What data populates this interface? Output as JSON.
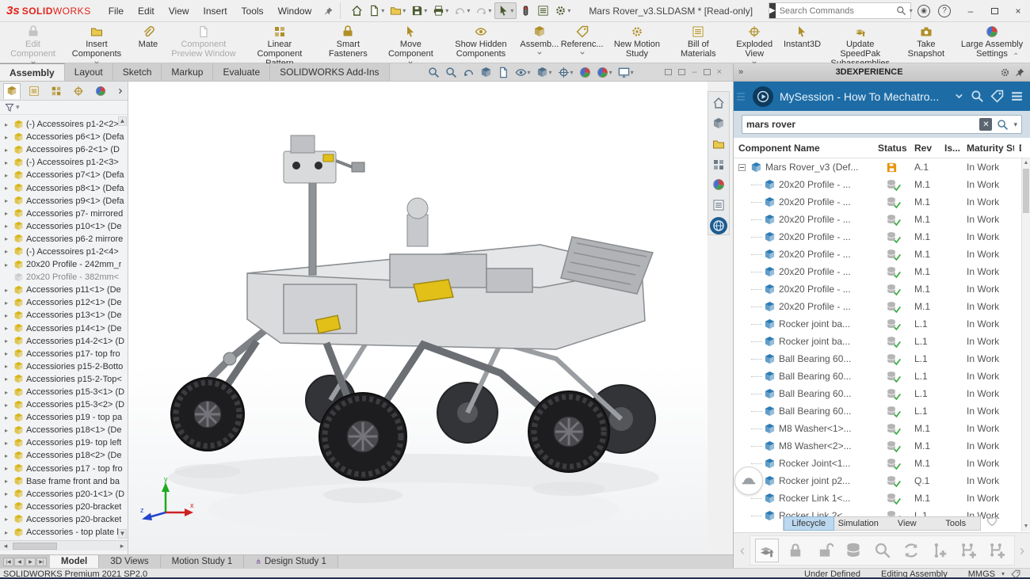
{
  "brand": {
    "mark": "3s",
    "name_bold": "SOLID",
    "name_light": "WORKS"
  },
  "titlebar": {
    "menus": [
      {
        "label": "File"
      },
      {
        "label": "Edit"
      },
      {
        "label": "View"
      },
      {
        "label": "Insert"
      },
      {
        "label": "Tools"
      },
      {
        "label": "Window"
      }
    ],
    "quick_access": [
      {
        "name": "home",
        "sym": "home"
      },
      {
        "name": "new-document",
        "sym": "doc",
        "dd": true
      },
      {
        "name": "open",
        "sym": "folder",
        "dd": true
      },
      {
        "name": "save",
        "sym": "floppy",
        "dd": true
      },
      {
        "name": "print",
        "sym": "printer",
        "dd": true
      },
      {
        "name": "undo",
        "sym": "undo",
        "dd": true,
        "dis": true
      },
      {
        "name": "redo",
        "sym": "redo",
        "dd": true,
        "dis": true
      },
      {
        "name": "select",
        "sym": "cursor",
        "dd": true,
        "sel": true
      },
      {
        "name": "connection-status",
        "sym": "traffic"
      },
      {
        "name": "task-pane-toggle",
        "sym": "list"
      },
      {
        "name": "options",
        "sym": "gear",
        "dd": true
      }
    ],
    "title": "Mars Rover_v3.SLDASM * [Read-only]",
    "search_placeholder": "Search Commands",
    "help_glyph": "?"
  },
  "ribbon": {
    "buttons": [
      {
        "name": "edit-component",
        "sym": "tool",
        "label": "Edit Component",
        "dd": true,
        "dis": true
      },
      {
        "name": "insert-components",
        "sym": "folder",
        "label": "Insert Components",
        "dd": true
      },
      {
        "name": "mate",
        "sym": "clip",
        "label": "Mate"
      },
      {
        "name": "component-preview-window",
        "sym": "doc",
        "label": "Component Preview Window",
        "dis": true
      },
      {
        "name": "linear-component-pattern",
        "sym": "grid",
        "label": "Linear Component Pattern",
        "dd": true
      },
      {
        "name": "smart-fasteners",
        "sym": "tool",
        "label": "Smart Fasteners"
      },
      {
        "name": "move-component",
        "sym": "cursor",
        "label": "Move Component",
        "dd": true
      },
      {
        "name": "show-hidden-components",
        "sym": "eye",
        "label": "Show Hidden Components"
      },
      {
        "name": "assembly-features",
        "sym": "cube",
        "label": "Assemb...",
        "dd": true
      },
      {
        "name": "reference-geometry",
        "sym": "tag",
        "label": "Referenc...",
        "dd": true
      },
      {
        "name": "new-motion-study",
        "sym": "gear",
        "label": "New Motion Study"
      },
      {
        "name": "bill-of-materials",
        "sym": "list",
        "label": "Bill of Materials"
      },
      {
        "name": "exploded-view",
        "sym": "target",
        "label": "Exploded View",
        "dd": true
      },
      {
        "name": "instant3d",
        "sym": "cursor",
        "label": "Instant3D"
      },
      {
        "name": "update-speedpak",
        "sym": "stackup",
        "label": "Update SpeedPak Subassemblies"
      },
      {
        "name": "take-snapshot",
        "sym": "camera",
        "label": "Take Snapshot"
      },
      {
        "name": "large-assembly-settings",
        "sym": "ball",
        "label": "Large Assembly Settings"
      }
    ]
  },
  "command_tabs": [
    {
      "label": "Assembly",
      "active": true
    },
    {
      "label": "Layout"
    },
    {
      "label": "Sketch"
    },
    {
      "label": "Markup"
    },
    {
      "label": "Evaluate"
    },
    {
      "label": "SOLIDWORKS Add-Ins"
    }
  ],
  "headsup": [
    {
      "name": "zoom-to-fit",
      "sym": "mag"
    },
    {
      "name": "zoom-to-area",
      "sym": "mag"
    },
    {
      "name": "previous-view",
      "sym": "undo"
    },
    {
      "name": "section-view",
      "sym": "cube"
    },
    {
      "name": "dynamic-annotation-views",
      "sym": "doc"
    },
    {
      "name": "hide-show-items",
      "sym": "eye",
      "dd": true
    },
    {
      "name": "display-style",
      "sym": "cube",
      "dd": true
    },
    {
      "name": "view-orientation",
      "sym": "target",
      "dd": true
    },
    {
      "name": "edit-appearance",
      "sym": "ball"
    },
    {
      "name": "apply-scene",
      "sym": "ball",
      "dd": true
    },
    {
      "name": "view-settings",
      "sym": "monitor",
      "dd": true
    }
  ],
  "tree": {
    "tabs": [
      {
        "name": "featuremanager",
        "sym": "cube",
        "active": true
      },
      {
        "name": "propertymanager",
        "sym": "list"
      },
      {
        "name": "configurationmanager",
        "sym": "grid"
      },
      {
        "name": "dimxpertmanager",
        "sym": "target"
      },
      {
        "name": "displaymanager",
        "sym": "ball"
      }
    ],
    "items": [
      {
        "label": "(-) Accessoires p1-2<2>"
      },
      {
        "label": "Accessories p6<1> (Defa"
      },
      {
        "label": "Accessoires p6-2<1> (D"
      },
      {
        "label": "(-) Accessoires p1-2<3>"
      },
      {
        "label": "Accessories p7<1> (Defa"
      },
      {
        "label": "Accessories p8<1> (Defa"
      },
      {
        "label": "Accessories p9<1> (Defa"
      },
      {
        "label": "Accessories p7- mirrored"
      },
      {
        "label": "Accessories p10<1> (De"
      },
      {
        "label": "Accessories p6-2 mirrore"
      },
      {
        "label": "(-) Accessoires p1-2<4>"
      },
      {
        "label": "20x20 Profile - 242mm_r"
      },
      {
        "label": "20x20 Profile - 382mm<",
        "ghost": true
      },
      {
        "label": "Accessories p11<1> (De"
      },
      {
        "label": "Accessories p12<1> (De"
      },
      {
        "label": "Accessories p13<1> (De"
      },
      {
        "label": "Accessories p14<1> (De"
      },
      {
        "label": "Accessories p14-2<1> (D"
      },
      {
        "label": "Accessories p17- top fro"
      },
      {
        "label": "Accessiories p15-2-Botto"
      },
      {
        "label": "Accessiories p15-2-Top<"
      },
      {
        "label": "Accessories p15-3<1> (D"
      },
      {
        "label": "Accessories p15-3<2> (D"
      },
      {
        "label": "Accessories p19 - top pa"
      },
      {
        "label": "Accessories p18<1> (De"
      },
      {
        "label": "Accessories p19- top left"
      },
      {
        "label": "Accessories p18<2> (De"
      },
      {
        "label": "Accessories p17 - top fro"
      },
      {
        "label": "Base frame front and ba"
      },
      {
        "label": "Accessories p20-1<1> (D"
      },
      {
        "label": "Accessories p20-bracket"
      },
      {
        "label": "Accessories p20-bracket"
      },
      {
        "label": "Accessories - top plate b"
      }
    ]
  },
  "taskstrip": [
    {
      "name": "home",
      "sym": "home"
    },
    {
      "name": "3dexperience-marketplace",
      "sym": "cube"
    },
    {
      "name": "design-library",
      "sym": "folder"
    },
    {
      "name": "appearances-scenes",
      "sym": "grid"
    },
    {
      "name": "custom-properties",
      "sym": "ball"
    },
    {
      "name": "file-explorer",
      "sym": "list"
    },
    {
      "name": "3dexperience",
      "sym": "globe",
      "active": true
    }
  ],
  "right_panel": {
    "header": "3DEXPERIENCE",
    "session": "MySession - How To Mechatro...",
    "search_value": "mars rover",
    "columns": [
      "Component Name",
      "Status",
      "Rev",
      "Is...",
      "Maturity State",
      "D"
    ],
    "rows": [
      {
        "name": "Mars Rover_v3 (Def...",
        "rev": "A.1",
        "maturity": "In Work",
        "status": "saved",
        "root": true
      },
      {
        "name": "20x20 Profile - ...",
        "rev": "M.1",
        "maturity": "In Work",
        "status": "synced"
      },
      {
        "name": "20x20 Profile - ...",
        "rev": "M.1",
        "maturity": "In Work",
        "status": "synced"
      },
      {
        "name": "20x20 Profile - ...",
        "rev": "M.1",
        "maturity": "In Work",
        "status": "synced"
      },
      {
        "name": "20x20 Profile - ...",
        "rev": "M.1",
        "maturity": "In Work",
        "status": "synced"
      },
      {
        "name": "20x20 Profile - ...",
        "rev": "M.1",
        "maturity": "In Work",
        "status": "synced"
      },
      {
        "name": "20x20 Profile - ...",
        "rev": "M.1",
        "maturity": "In Work",
        "status": "synced"
      },
      {
        "name": "20x20 Profile - ...",
        "rev": "M.1",
        "maturity": "In Work",
        "status": "synced"
      },
      {
        "name": "20x20 Profile - ...",
        "rev": "M.1",
        "maturity": "In Work",
        "status": "synced"
      },
      {
        "name": "Rocker joint ba...",
        "rev": "L.1",
        "maturity": "In Work",
        "status": "synced"
      },
      {
        "name": "Rocker joint ba...",
        "rev": "L.1",
        "maturity": "In Work",
        "status": "synced"
      },
      {
        "name": "Ball Bearing 60...",
        "rev": "L.1",
        "maturity": "In Work",
        "status": "synced"
      },
      {
        "name": "Ball Bearing 60...",
        "rev": "L.1",
        "maturity": "In Work",
        "status": "synced"
      },
      {
        "name": "Ball Bearing 60...",
        "rev": "L.1",
        "maturity": "In Work",
        "status": "synced"
      },
      {
        "name": "Ball Bearing 60...",
        "rev": "L.1",
        "maturity": "In Work",
        "status": "synced"
      },
      {
        "name": "M8 Washer<1>...",
        "rev": "M.1",
        "maturity": "In Work",
        "status": "synced"
      },
      {
        "name": "M8 Washer<2>...",
        "rev": "M.1",
        "maturity": "In Work",
        "status": "synced"
      },
      {
        "name": "Rocker Joint<1...",
        "rev": "M.1",
        "maturity": "In Work",
        "status": "synced"
      },
      {
        "name": "Rocker joint p2...",
        "rev": "Q.1",
        "maturity": "In Work",
        "status": "synced"
      },
      {
        "name": "Rocker Link 1<...",
        "rev": "M.1",
        "maturity": "In Work",
        "status": "synced"
      },
      {
        "name": "Rocker Link 2<...",
        "rev": "L.1",
        "maturity": "In Work",
        "status": "synced"
      }
    ],
    "tabs": [
      {
        "label": "Lifecycle",
        "active": true
      },
      {
        "label": "Simulation"
      },
      {
        "label": "View"
      },
      {
        "label": "Tools"
      }
    ],
    "toolbar": [
      {
        "name": "save-to-3dexperience",
        "sym": "stackup",
        "active": true
      },
      {
        "name": "lock",
        "sym": "lock"
      },
      {
        "name": "unlock",
        "sym": "unlock"
      },
      {
        "name": "refresh-from-database",
        "sym": "db"
      },
      {
        "name": "explore",
        "sym": "mag"
      },
      {
        "name": "new-revision",
        "sym": "sync"
      },
      {
        "name": "insert-existing-1",
        "sym": "plusline"
      },
      {
        "name": "insert-existing-2",
        "sym": "plusbranch"
      },
      {
        "name": "insert-existing-3",
        "sym": "plusbranch"
      }
    ]
  },
  "doc_tabs": [
    {
      "label": "Model",
      "active": true
    },
    {
      "label": "3D Views"
    },
    {
      "label": "Motion Study 1"
    },
    {
      "label": "Design Study 1",
      "icon": true
    }
  ],
  "statusbar": {
    "left": "SOLIDWORKS Premium 2021 SP2.0",
    "constraint": "Under Defined",
    "mode": "Editing Assembly",
    "units": "MMGS"
  },
  "triad": {
    "x": "x",
    "y": "y",
    "z": "z"
  }
}
